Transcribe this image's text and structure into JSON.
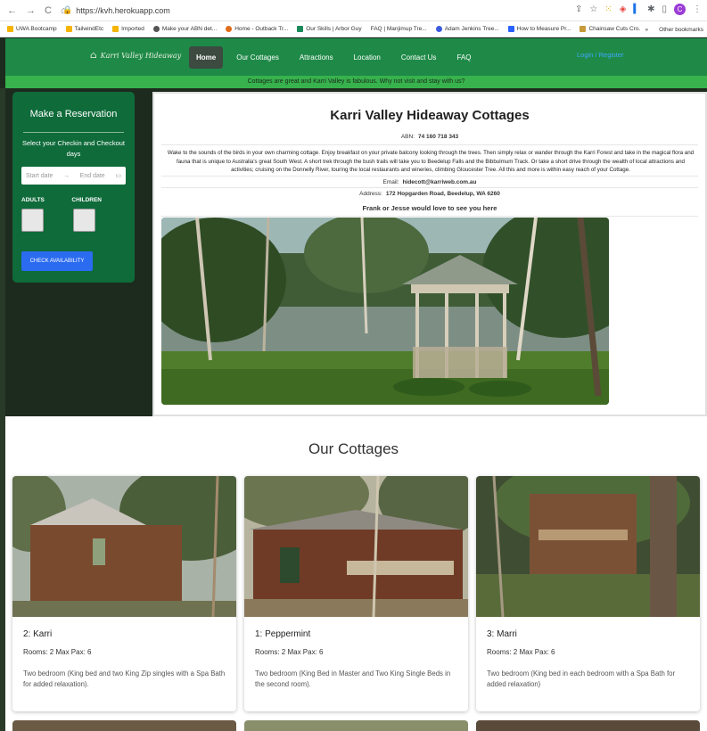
{
  "browser": {
    "url": "https://kvh.herokuapp.com",
    "bookmarks": [
      "UWA Bootcamp",
      "TailwindEtc",
      "Imported",
      "Make your ABN det...",
      "Home - Outback Tr...",
      "Our Skills | Arbor Guy",
      "FAQ | Manjimup Tre...",
      "Adam Jenkins Tree...",
      "How to Measure Pr...",
      "Chainsaw Cuts Cro..."
    ],
    "other_bookmarks": "Other bookmarks",
    "profile_initial": "C"
  },
  "nav": {
    "logo": "Karri Valley Hideaway",
    "links": [
      "Home",
      "Our Cottages",
      "Attractions",
      "Location",
      "Contact Us",
      "FAQ"
    ],
    "login": "Login / Register"
  },
  "banner": "Cottages are great and Karri Valley is fabulous.   Why not visit and stay with us?",
  "reservation": {
    "title": "Make a Reservation",
    "subtitle": "Select your Checkin and Checkout days",
    "start_placeholder": "Start date",
    "end_placeholder": "End date",
    "adults_label": "ADULTS",
    "children_label": "CHILDREN",
    "button": "CHECK AVAILABILITY"
  },
  "intro": {
    "title": "Karri Valley Hideaway Cottages",
    "abn_label": "ABN:",
    "abn": "74 160 718 343",
    "description": "Wake to the sounds of the birds in your own charming cottage. Enjoy breakfast on your private balcony looking through the trees. Then simply relax or wander through the Karri Forest and take in the magical flora and fauna that is unique to Australia's great South West. A short trek through the bush trails will take you to Beedelup Falls and the Bibbulmum Track. Or take a short drive through the wealth of local attractions and activities; cruising on the Donnelly River, touring the local restaurants and wineries, climbing Gloucester Tree. All this and more is within easy reach of your Cottage.",
    "email_label": "Email:",
    "email": "hidecott@karriweb.com.au",
    "address_label": "Address:",
    "address": "172 Hopgarden Road, Beedelup, WA 6260",
    "tagline": "Frank or Jesse would love to see you here"
  },
  "cottages_title": "Our Cottages",
  "cottages": [
    {
      "name": "2:  Karri",
      "rooms": "Rooms: 2    Max Pax: 6",
      "description": "Two bedroom (King bed and two King Zip singles with a Spa Bath for added relaxation)."
    },
    {
      "name": "1:  Peppermint",
      "rooms": "Rooms: 2    Max Pax: 6",
      "description": "Two bedroom (King Bed in Master and Two King Single Beds in the second room)."
    },
    {
      "name": "3:  Marri",
      "rooms": "Rooms: 2    Max Pax: 6",
      "description": "Two bedroom (King bed in each bedroom with a Spa Bath for added relaxation)"
    }
  ],
  "colors": {
    "nav_green": "#1f8a48",
    "banner_green": "#37b24d",
    "reservation_green": "#0f6b3a",
    "button_blue": "#2b6bf0"
  }
}
